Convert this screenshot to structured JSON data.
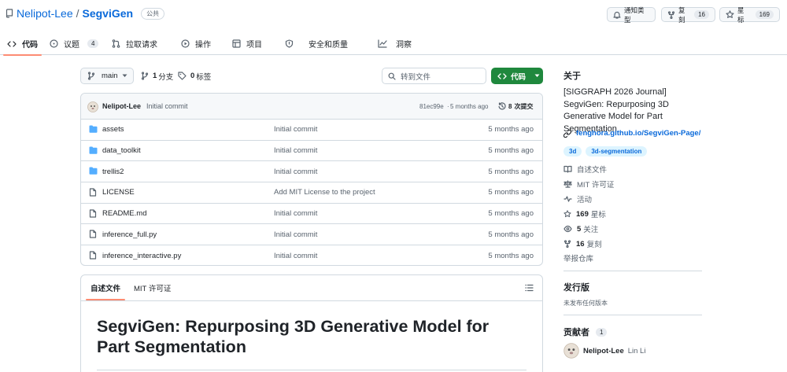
{
  "repo": {
    "owner": "Nelipot-Lee",
    "sep": "/",
    "name": "SegviGen",
    "visibility": "公共"
  },
  "header_actions": {
    "notify_label": "通知类型",
    "fork_label": "复刻",
    "fork_count": "16",
    "star_label": "星标",
    "star_count": "169"
  },
  "tabs": [
    {
      "label": "代码"
    },
    {
      "label": "议题",
      "count": "4"
    },
    {
      "label": "拉取请求"
    },
    {
      "label": "操作"
    },
    {
      "label": "项目"
    },
    {
      "label": "安全和质量"
    },
    {
      "label": "洞察"
    }
  ],
  "toolbar": {
    "branch": "main",
    "branches_count": "1",
    "branches_label": "分支",
    "tags_count": "0",
    "tags_label": "标签",
    "search_placeholder": "转到文件",
    "code_label": "代码"
  },
  "commit": {
    "author": "Nelipot-Lee",
    "message": "Initial commit",
    "hash": "81ec99e",
    "sep": "·",
    "age": "5 months ago",
    "count": "8",
    "count_label": "次提交"
  },
  "files": [
    {
      "name": "assets",
      "type": "dir",
      "message": "Initial commit",
      "age": "5 months ago"
    },
    {
      "name": "data_toolkit",
      "type": "dir",
      "message": "Initial commit",
      "age": "5 months ago"
    },
    {
      "name": "trellis2",
      "type": "dir",
      "message": "Initial commit",
      "age": "5 months ago"
    },
    {
      "name": "LICENSE",
      "type": "file",
      "message": "Add MIT License to the project",
      "age": "5 months ago"
    },
    {
      "name": "README.md",
      "type": "file",
      "message": "Initial commit",
      "age": "5 months ago"
    },
    {
      "name": "inference_full.py",
      "type": "file",
      "message": "Initial commit",
      "age": "5 months ago"
    },
    {
      "name": "inference_interactive.py",
      "type": "file",
      "message": "Initial commit",
      "age": "5 months ago"
    }
  ],
  "readme": {
    "tab_readme": "自述文件",
    "tab_license": "MIT 许可证",
    "title": "SegviGen: Repurposing 3D Generative Model for Part Segmentation"
  },
  "about": {
    "heading": "关于",
    "description": "[SIGGRAPH 2026 Journal] SegviGen: Repurposing 3D Generative Model for Part Segmentation",
    "link": "fenghora.github.io/SegviGen-Page/",
    "topics": [
      "3d",
      "3d-segmentation"
    ],
    "readme": "自述文件",
    "license": "MIT 许可证",
    "activity": "活动",
    "stars_count": "169",
    "stars_label": "星标",
    "watch_count": "5",
    "watch_label": "关注",
    "forks_count": "16",
    "forks_label": "复刻",
    "report": "举报仓库"
  },
  "releases": {
    "heading": "发行版",
    "none": "未发布任何版本"
  },
  "contributors": {
    "heading": "贡献者",
    "count": "1",
    "name": "Nelipot-Lee",
    "fullname": "Lin Li"
  }
}
